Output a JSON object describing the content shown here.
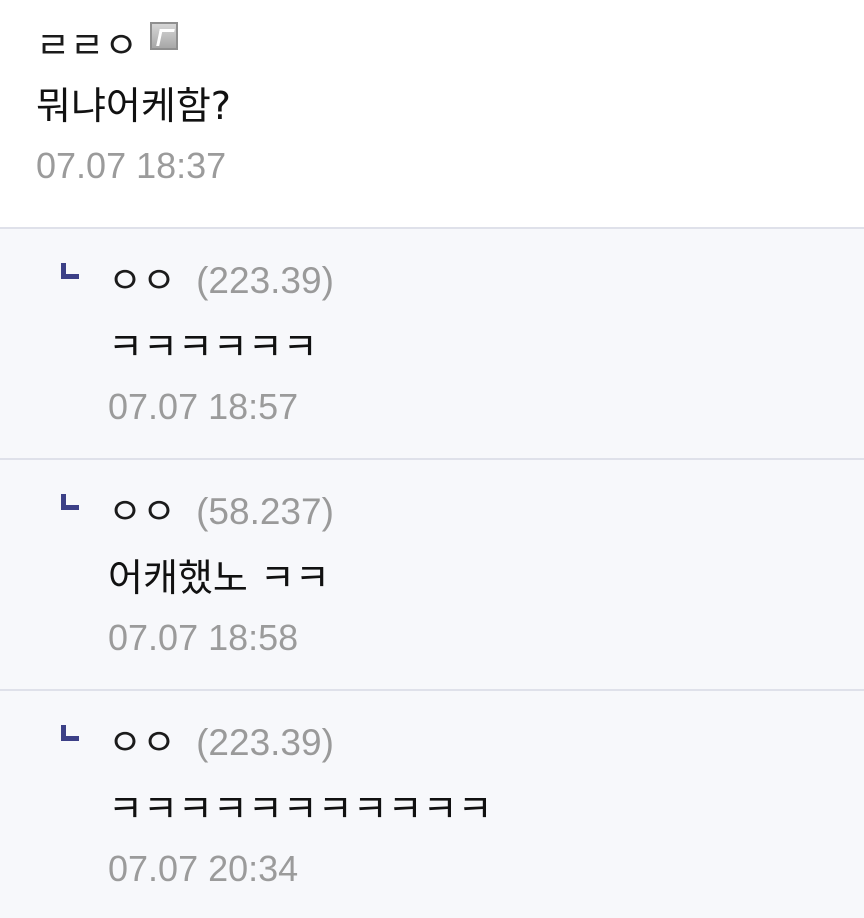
{
  "colors": {
    "reply_background": "#f7f8fb",
    "divider": "#dfe1ea",
    "reply_icon": "#3c4087",
    "meta_text": "#9b9b9b"
  },
  "comments": [
    {
      "nickname": "ㄹㄹㅇ",
      "has_badge": true,
      "badge_icon": "fixed-nick-badge-icon",
      "text": "뭐냐어케함?",
      "time": "07.07 18:37"
    }
  ],
  "replies": [
    {
      "icon": "reply-arrow-icon",
      "nickname": "ㅇㅇ",
      "ip": "(223.39)",
      "text": "ㅋㅋㅋㅋㅋㅋ",
      "time": "07.07 18:57"
    },
    {
      "icon": "reply-arrow-icon",
      "nickname": "ㅇㅇ",
      "ip": "(58.237)",
      "text": "어캐했노 ㅋㅋ",
      "time": "07.07 18:58"
    },
    {
      "icon": "reply-arrow-icon",
      "nickname": "ㅇㅇ",
      "ip": "(223.39)",
      "text": "ㅋㅋㅋㅋㅋㅋㅋㅋㅋㅋㅋ",
      "time": "07.07 20:34"
    }
  ]
}
